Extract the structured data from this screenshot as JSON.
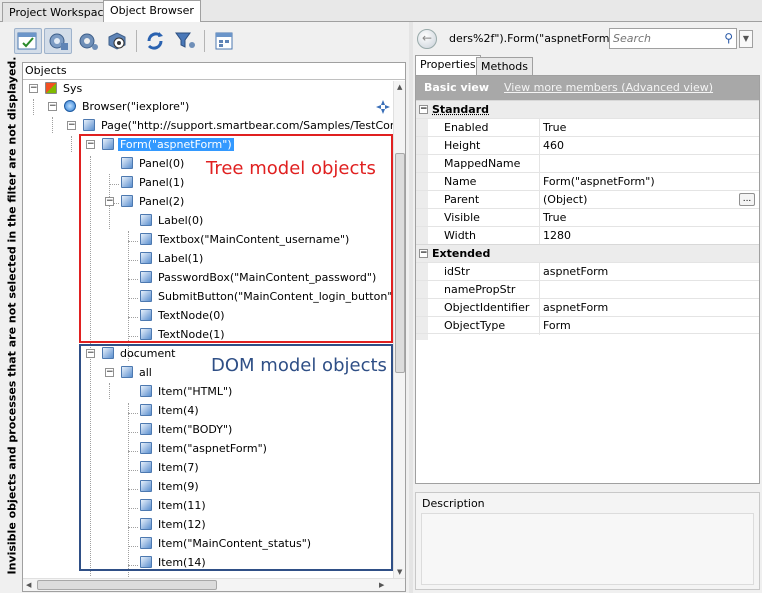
{
  "top_tabs": {
    "project_workspace": "Project Workspace",
    "object_browser": "Object Browser"
  },
  "filter_notice": "Invisible objects and processes that are not selected in the filter are not displayed.",
  "tree": {
    "header": "Objects",
    "nodes": [
      {
        "label": "Sys"
      },
      {
        "label": "Browser(\"iexplore\")"
      },
      {
        "label": "Page(\"http://support.smartbear.com/Samples/TestComplete"
      },
      {
        "label": "Form(\"aspnetForm\")"
      },
      {
        "label": "Panel(0)"
      },
      {
        "label": "Panel(1)"
      },
      {
        "label": "Panel(2)"
      },
      {
        "label": "Label(0)"
      },
      {
        "label": "Textbox(\"MainContent_username\")"
      },
      {
        "label": "Label(1)"
      },
      {
        "label": "PasswordBox(\"MainContent_password\")"
      },
      {
        "label": "SubmitButton(\"MainContent_login_button\")"
      },
      {
        "label": "TextNode(0)"
      },
      {
        "label": "TextNode(1)"
      },
      {
        "label": "document"
      },
      {
        "label": "all"
      },
      {
        "label": "Item(\"HTML\")"
      },
      {
        "label": "Item(4)"
      },
      {
        "label": "Item(\"BODY\")"
      },
      {
        "label": "Item(\"aspnetForm\")"
      },
      {
        "label": "Item(7)"
      },
      {
        "label": "Item(9)"
      },
      {
        "label": "Item(11)"
      },
      {
        "label": "Item(12)"
      },
      {
        "label": "Item(\"MainContent_status\")"
      },
      {
        "label": "Item(14)"
      }
    ]
  },
  "annotations": {
    "tree_model": "Tree model objects",
    "dom_model": "DOM model objects"
  },
  "right": {
    "object_path": "ders%2f\").Form(\"aspnetForm\")",
    "search_placeholder": "Search",
    "tabs": {
      "properties": "Properties",
      "methods": "Methods"
    },
    "basic_view": "Basic view",
    "more_link": "View more members (Advanced view)",
    "groups": [
      {
        "name": "Standard",
        "rows": [
          {
            "name": "Enabled",
            "value": "True"
          },
          {
            "name": "Height",
            "value": "460"
          },
          {
            "name": "MappedName",
            "value": ""
          },
          {
            "name": "Name",
            "value": "Form(\"aspnetForm\")"
          },
          {
            "name": "Parent",
            "value": "(Object)"
          },
          {
            "name": "Visible",
            "value": "True"
          },
          {
            "name": "Width",
            "value": "1280"
          }
        ]
      },
      {
        "name": "Extended",
        "rows": [
          {
            "name": "idStr",
            "value": "aspnetForm"
          },
          {
            "name": "namePropStr",
            "value": ""
          },
          {
            "name": "ObjectIdentifier",
            "value": "aspnetForm"
          },
          {
            "name": "ObjectType",
            "value": "Form"
          }
        ]
      }
    ],
    "description_title": "Description",
    "ellipsis": "..."
  },
  "colors": {
    "tree_box": "#e02020",
    "dom_box": "#2f4f86",
    "selection": "#3399ff"
  }
}
